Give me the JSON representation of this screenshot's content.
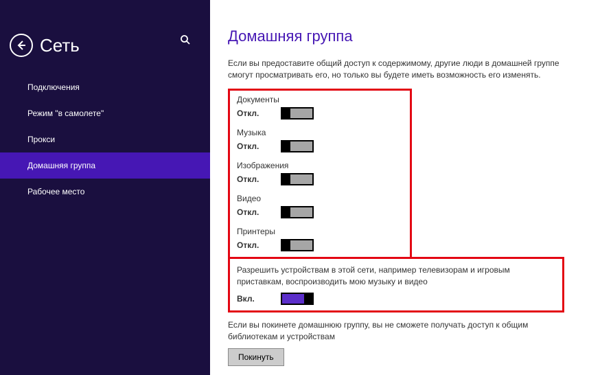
{
  "sidebar": {
    "title": "Сеть",
    "items": [
      {
        "label": "Подключения"
      },
      {
        "label": "Режим \"в самолете\""
      },
      {
        "label": "Прокси"
      },
      {
        "label": "Домашняя группа"
      },
      {
        "label": "Рабочее место"
      }
    ]
  },
  "main": {
    "title": "Домашняя группа",
    "description": "Если вы предоставите общий доступ к содержимому, другие люди в домашней группе смогут просматривать его, но только вы будете иметь возможность его изменять.",
    "toggles": [
      {
        "label": "Документы",
        "state": "Откл."
      },
      {
        "label": "Музыка",
        "state": "Откл."
      },
      {
        "label": "Изображения",
        "state": "Откл."
      },
      {
        "label": "Видео",
        "state": "Откл."
      },
      {
        "label": "Принтеры",
        "state": "Откл."
      }
    ],
    "media_section": {
      "text": "Разрешить устройствам в этой сети, например телевизорам и игровым приставкам, воспроизводить мою музыку и видео",
      "state": "Вкл."
    },
    "leave_text": "Если вы покинете домашнюю группу, вы не сможете получать доступ к общим библиотекам и устройствам",
    "leave_button": "Покинуть"
  }
}
